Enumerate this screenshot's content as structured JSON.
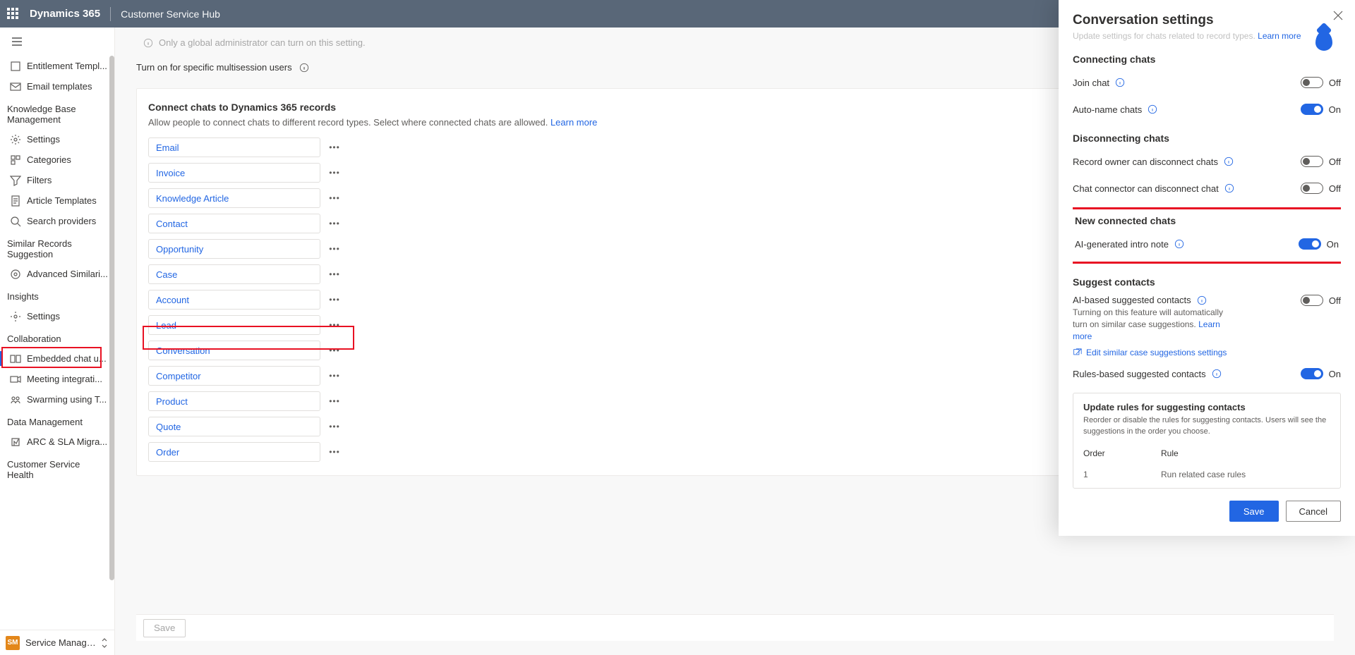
{
  "header": {
    "brand": "Dynamics 365",
    "area": "Customer Service Hub"
  },
  "sidebar": {
    "items_top": [
      {
        "label": "Entitlement Templ..."
      },
      {
        "label": "Email templates"
      }
    ],
    "groups": [
      {
        "heading": "Knowledge Base Management",
        "items": [
          {
            "label": "Settings"
          },
          {
            "label": "Categories"
          },
          {
            "label": "Filters"
          },
          {
            "label": "Article Templates"
          },
          {
            "label": "Search providers"
          }
        ]
      },
      {
        "heading": "Similar Records Suggestion",
        "items": [
          {
            "label": "Advanced Similari..."
          }
        ]
      },
      {
        "heading": "Insights",
        "items": [
          {
            "label": "Settings"
          }
        ]
      },
      {
        "heading": "Collaboration",
        "items": [
          {
            "label": "Embedded chat u...",
            "selected": true
          },
          {
            "label": "Meeting integrati..."
          },
          {
            "label": "Swarming using T..."
          }
        ]
      },
      {
        "heading": "Data Management",
        "items": [
          {
            "label": "ARC & SLA Migra..."
          }
        ]
      },
      {
        "heading": "Customer Service Health",
        "items": []
      }
    ],
    "area_switcher": {
      "chip": "SM",
      "label": "Service Managem..."
    }
  },
  "main": {
    "admin_note": "Only a global administrator can turn on this setting.",
    "turn_on_label": "Turn on for specific multisession users",
    "card": {
      "title": "Connect chats to Dynamics 365 records",
      "subtitle": "Allow people to connect chats to different record types. Select where connected chats are allowed.",
      "learn_more": "Learn more",
      "records": [
        "Email",
        "Invoice",
        "Knowledge Article",
        "Contact",
        "Opportunity",
        "Case",
        "Account",
        "Lead",
        "Conversation",
        "Competitor",
        "Product",
        "Quote",
        "Order"
      ]
    },
    "save_label": "Save"
  },
  "panel": {
    "title": "Conversation settings",
    "cut_text": "Update settings for chats related to record types.",
    "cut_link": "Learn more",
    "sections": {
      "connecting": {
        "heading": "Connecting chats",
        "join": {
          "label": "Join chat",
          "state": "Off",
          "on": false
        },
        "auto": {
          "label": "Auto-name chats",
          "state": "On",
          "on": true
        }
      },
      "disconnecting": {
        "heading": "Disconnecting chats",
        "owner": {
          "label": "Record owner can disconnect chats",
          "state": "Off",
          "on": false
        },
        "connector": {
          "label": "Chat connector can disconnect chat",
          "state": "Off",
          "on": false
        }
      },
      "newchats": {
        "heading": "New connected chats",
        "ai_intro": {
          "label": "AI-generated intro note",
          "state": "On",
          "on": true
        }
      },
      "suggest": {
        "heading": "Suggest contacts",
        "ai": {
          "label": "AI-based suggested contacts",
          "state": "Off",
          "on": false,
          "help": "Turning on this feature will automatically turn on similar case suggestions.",
          "help_link": "Learn more",
          "edit_link": "Edit similar case suggestions settings"
        },
        "rules_toggle": {
          "label": "Rules-based suggested contacts",
          "state": "On",
          "on": true
        },
        "rules_box": {
          "title": "Update rules for suggesting contacts",
          "sub": "Reorder or disable the rules for suggesting contacts. Users will see the suggestions in the order you choose.",
          "cols": {
            "order": "Order",
            "rule": "Rule"
          },
          "rows": [
            {
              "order": "1",
              "rule": "Run related case rules"
            }
          ]
        }
      }
    },
    "footer": {
      "save": "Save",
      "cancel": "Cancel"
    }
  }
}
